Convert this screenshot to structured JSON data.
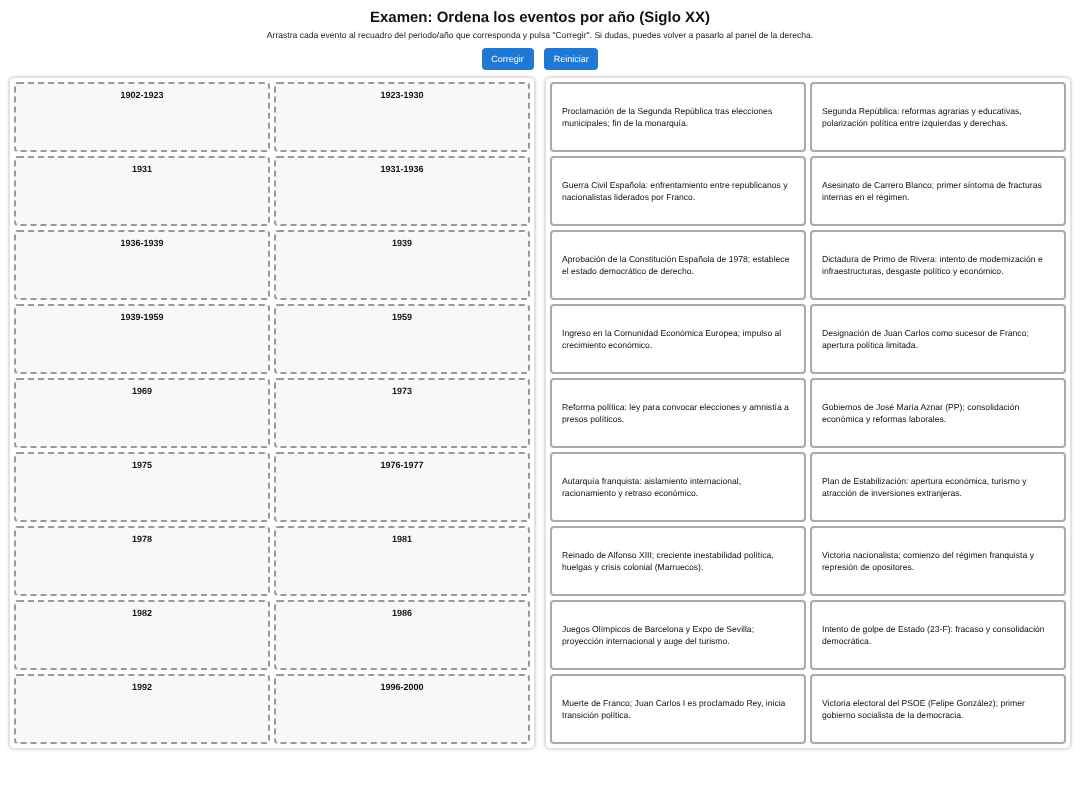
{
  "title": "Examen: Ordena los eventos por año (Siglo XX)",
  "instructions": "Arrastra cada evento al recuadro del periodo/año que corresponda y pulsa \"Corregir\". Si dudas, puedes volver a pasarlo al panel de la derecha.",
  "buttons": [
    "Corregir",
    "Reiniciar"
  ],
  "slots": [
    "1902-1923",
    "1923-1930",
    "1931",
    "1931-1936",
    "1936-1939",
    "1939",
    "1939-1959",
    "1959",
    "1969",
    "1973",
    "1975",
    "1976-1977",
    "1978",
    "1981",
    "1982",
    "1986",
    "1992",
    "1996-2000"
  ],
  "events": [
    "Proclamación de la Segunda República tras elecciones municipales; fin de la monarquía.",
    "Segunda República: reformas agrarias y educativas, polarización política entre izquierdas y derechas.",
    "Guerra Civil Española: enfrentamiento entre republicanos y nacionalistas liderados por Franco.",
    "Asesinato de Carrero Blanco; primer síntoma de fracturas internas en el régimen.",
    "Aprobación de la Constitución Española de 1978; establece el estado democrático de derecho.",
    "Dictadura de Primo de Rivera: intento de modernización e infraestructuras, desgaste político y económico.",
    "Ingreso en la Comunidad Económica Europea; impulso al crecimiento económico.",
    "Designación de Juan Carlos como sucesor de Franco; apertura política limitada.",
    "Reforma política: ley para convocar elecciones y amnistía a presos políticos.",
    "Gobiernos de José María Aznar (PP); consolidación económica y reformas laborales.",
    "Autarquía franquista: aislamiento internacional, racionamiento y retraso económico.",
    "Plan de Estabilización: apertura económica, turismo y atracción de inversiones extranjeras.",
    "Reinado de Alfonso XIII; creciente inestabilidad política, huelgas y crisis colonial (Marruecos).",
    "Victoria nacionalista; comienzo del régimen franquista y represión de opositores.",
    "Juegos Olímpicos de Barcelona y Expo de Sevilla; proyección internacional y auge del turismo.",
    "Intento de golpe de Estado (23-F): fracaso y consolidación democrática.",
    "Muerte de Franco; Juan Carlos I es proclamado Rey, inicia transición política.",
    "Victoria electoral del PSOE (Felipe González); primer gobierno socialista de la democracia."
  ]
}
